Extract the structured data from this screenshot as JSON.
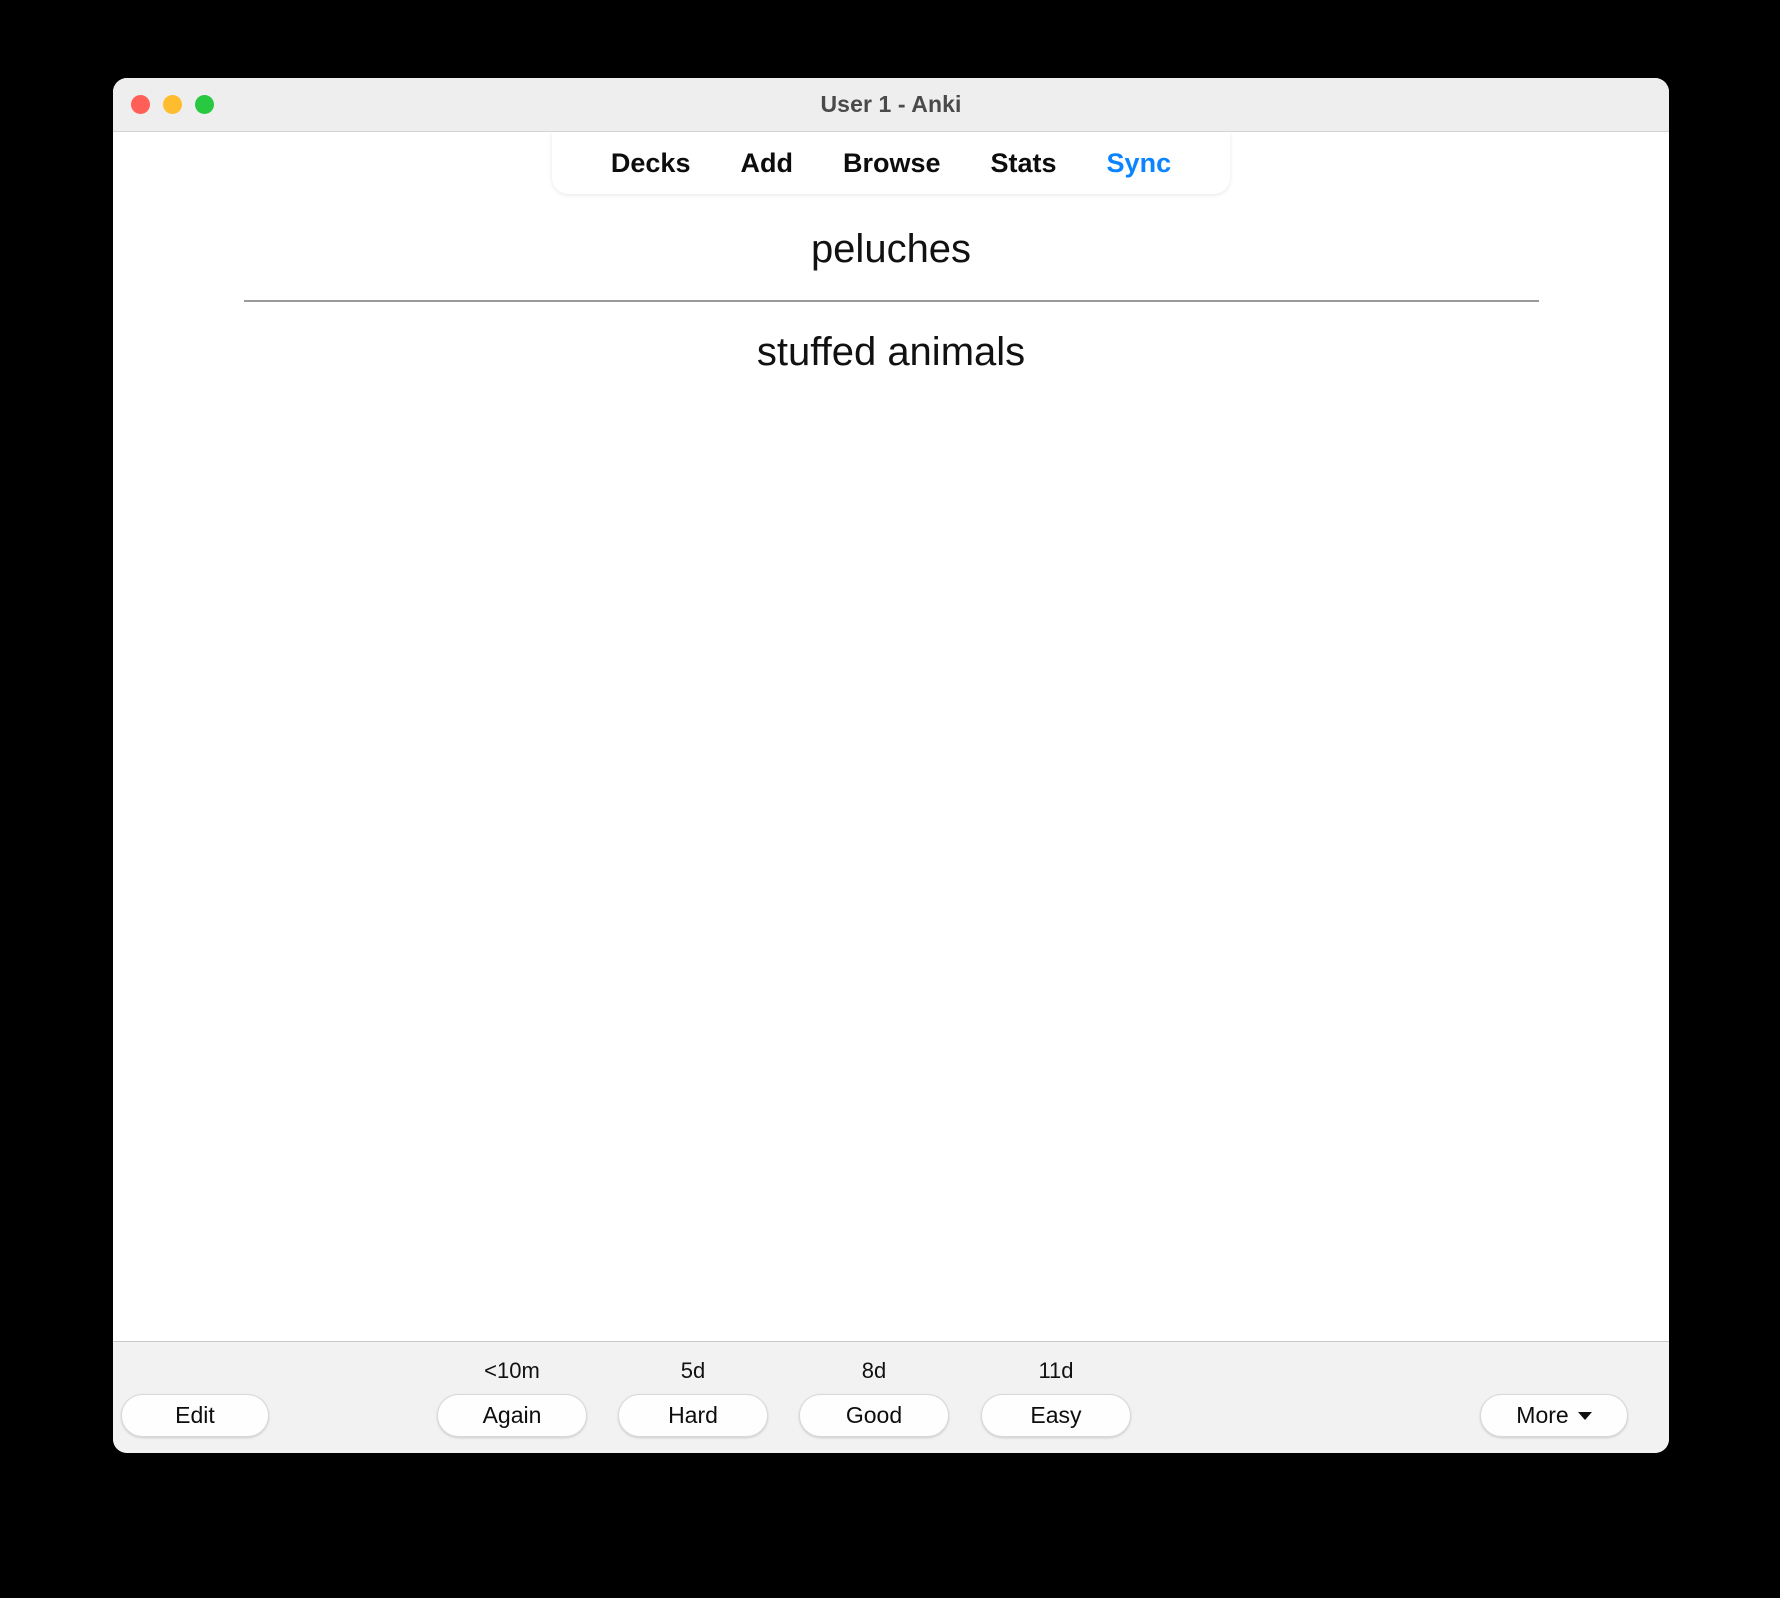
{
  "window": {
    "title": "User 1 - Anki",
    "traffic_lights": [
      {
        "name": "close",
        "color": "#ff5f57"
      },
      {
        "name": "minimize",
        "color": "#febc2e"
      },
      {
        "name": "maximize",
        "color": "#28c840"
      }
    ]
  },
  "nav": {
    "items": [
      {
        "label": "Decks",
        "active": false
      },
      {
        "label": "Add",
        "active": false
      },
      {
        "label": "Browse",
        "active": false
      },
      {
        "label": "Stats",
        "active": false
      },
      {
        "label": "Sync",
        "active": true
      }
    ],
    "accent_color": "#0a84ff"
  },
  "card": {
    "question": "peluches",
    "answer": "stuffed animals"
  },
  "bottom_bar": {
    "edit_label": "Edit",
    "more_label": "More",
    "answer_buttons": [
      {
        "label": "Again",
        "interval": "<10m"
      },
      {
        "label": "Hard",
        "interval": "5d"
      },
      {
        "label": "Good",
        "interval": "8d"
      },
      {
        "label": "Easy",
        "interval": "11d"
      }
    ]
  }
}
